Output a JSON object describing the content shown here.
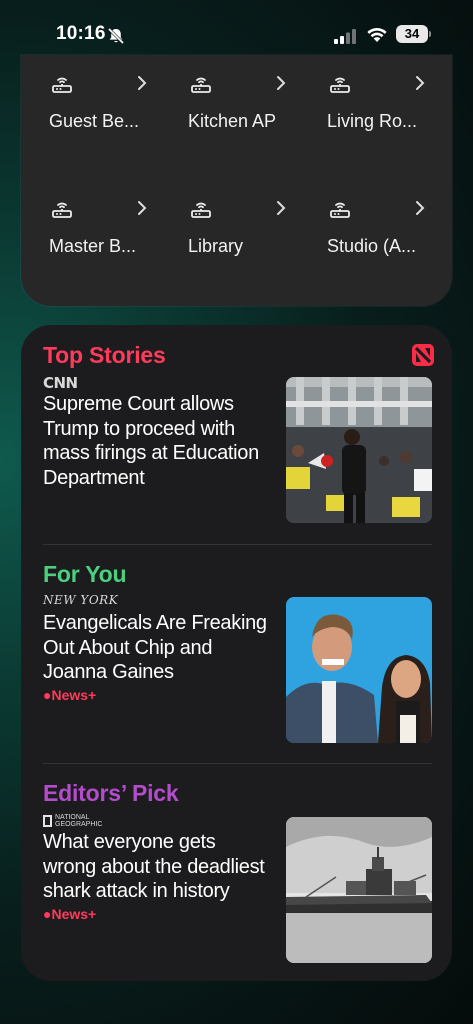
{
  "status_bar": {
    "time": "10:16",
    "battery": "34"
  },
  "home_devices": [
    {
      "label": "Guest Be..."
    },
    {
      "label": "Kitchen AP"
    },
    {
      "label": "Living Ro..."
    },
    {
      "label": "Master B..."
    },
    {
      "label": "Library"
    },
    {
      "label": "Studio (A..."
    }
  ],
  "news": {
    "sections": [
      {
        "title": "Top Stories",
        "title_color": "#ff3b5c",
        "source": "CNN",
        "headline": "Supreme Court allows Trump to proceed with mass firings at Education Department",
        "badge": ""
      },
      {
        "title": "For You",
        "title_color": "#4cd080",
        "source": "NEW YORK",
        "headline": "Evangelicals Are Freaking Out About Chip and Joanna Gaines",
        "badge": "News+"
      },
      {
        "title": "Editors’ Pick",
        "title_color": "#b34dcc",
        "source": "NATIONAL GEOGRAPHIC",
        "headline": "What everyone gets wrong about the deadliest shark attack in history",
        "badge": "News+"
      }
    ]
  },
  "colors": {
    "accent_red": "#ff3b5c",
    "accent_green": "#4cd080",
    "accent_purple": "#b34dcc"
  },
  "icons": [
    "bell-slash-icon",
    "cellular-signal-icon",
    "wifi-icon",
    "battery-icon",
    "access-point-icon",
    "chevron-right-icon",
    "apple-news-icon",
    "apple-logo-icon"
  ]
}
